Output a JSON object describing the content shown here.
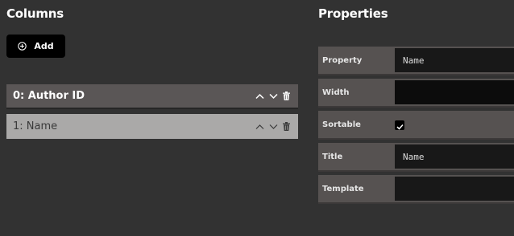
{
  "columns_panel": {
    "title": "Columns",
    "add_label": "Add",
    "rows": [
      {
        "label": "0: Author ID"
      },
      {
        "label": "1: Name"
      }
    ]
  },
  "properties_panel": {
    "title": "Properties",
    "fields": {
      "property": {
        "label": "Property",
        "value": "Name"
      },
      "width": {
        "label": "Width",
        "value": ""
      },
      "sortable": {
        "label": "Sortable",
        "checked": true
      },
      "title": {
        "label": "Title",
        "value": "Name"
      },
      "template": {
        "label": "Template",
        "value": ""
      }
    }
  }
}
